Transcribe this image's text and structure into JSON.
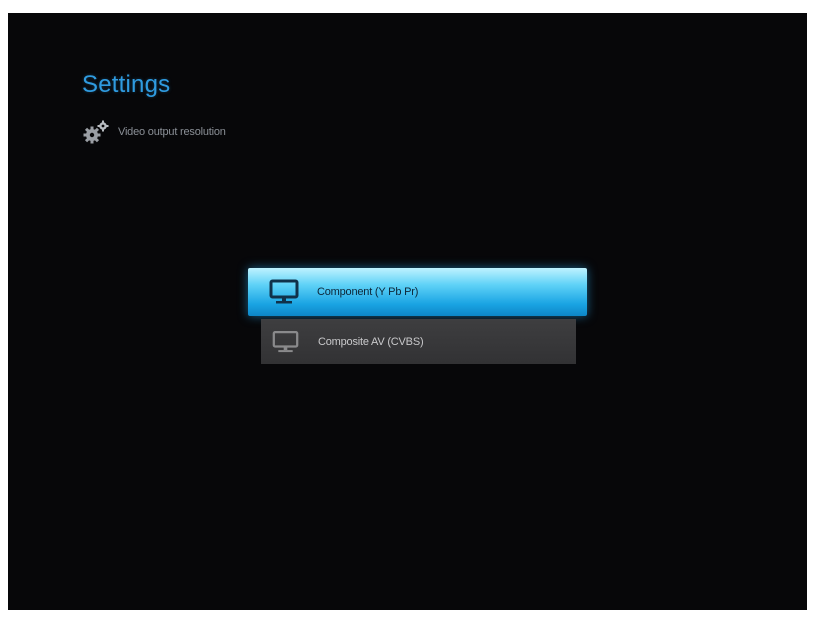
{
  "page": {
    "title": "Settings",
    "subtitle": "Video output resolution",
    "subtitle_icon": "gears-icon"
  },
  "menu": {
    "items": [
      {
        "label": "Component (Y Pb Pr)",
        "icon": "monitor-icon",
        "selected": true
      },
      {
        "label": "Composite AV (CVBS)",
        "icon": "monitor-icon",
        "selected": false
      }
    ]
  },
  "colors": {
    "background": "#070709",
    "title": "#2f9be0",
    "selected_highlight": "#1aa4e3",
    "unselected_item": "#3a3a3c"
  }
}
